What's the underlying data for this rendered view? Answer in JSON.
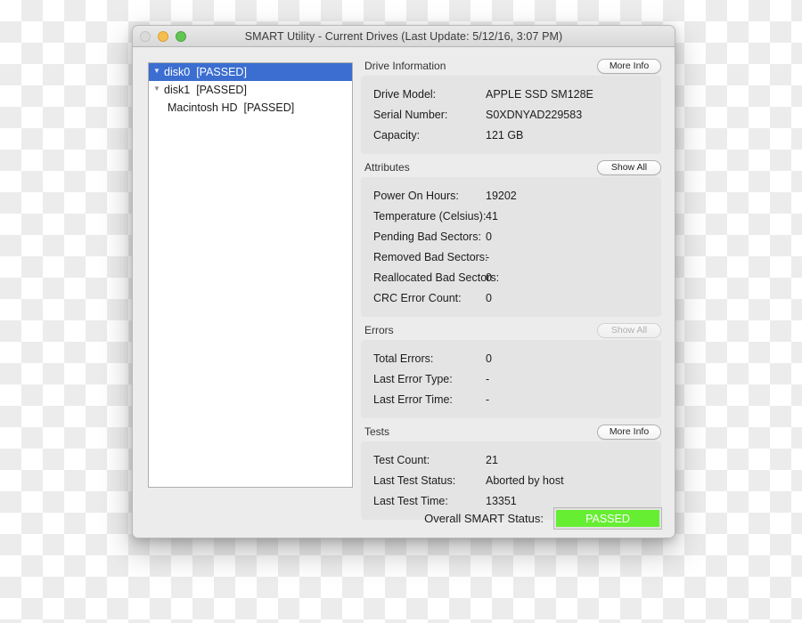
{
  "window": {
    "title": "SMART Utility - Current Drives (Last Update: 5/12/16, 3:07 PM)",
    "traffic_lights": {
      "close": "close-button",
      "minimize": "minimize-button",
      "zoom": "zoom-button"
    }
  },
  "drive_list": [
    {
      "name": "disk0",
      "status": "[PASSED]",
      "expanded": true,
      "indent": false,
      "selected": true
    },
    {
      "name": "disk1",
      "status": "[PASSED]",
      "expanded": true,
      "indent": false,
      "selected": false
    },
    {
      "name": "Macintosh HD",
      "status": "[PASSED]",
      "expanded": false,
      "indent": true,
      "selected": false
    }
  ],
  "sections": [
    {
      "title": "Drive Information",
      "button": {
        "label": "More Info",
        "disabled": false
      },
      "rows": [
        {
          "label": "Drive Model:",
          "value": "APPLE SSD SM128E"
        },
        {
          "label": "Serial Number:",
          "value": "S0XDNYAD229583"
        },
        {
          "label": "Capacity:",
          "value": "121 GB"
        }
      ]
    },
    {
      "title": "Attributes",
      "button": {
        "label": "Show All",
        "disabled": false
      },
      "rows": [
        {
          "label": "Power On Hours:",
          "value": "19202"
        },
        {
          "label": "Temperature (Celsius):",
          "value": "41"
        },
        {
          "label": "Pending Bad Sectors:",
          "value": "0"
        },
        {
          "label": "Removed Bad Sectors:",
          "value": "-"
        },
        {
          "label": "Reallocated Bad Sectors:",
          "value": "0"
        },
        {
          "label": "CRC Error Count:",
          "value": "0"
        }
      ]
    },
    {
      "title": "Errors",
      "button": {
        "label": "Show All",
        "disabled": true
      },
      "rows": [
        {
          "label": "Total Errors:",
          "value": "0"
        },
        {
          "label": "Last Error Type:",
          "value": "-"
        },
        {
          "label": "Last Error Time:",
          "value": "-"
        }
      ]
    },
    {
      "title": "Tests",
      "button": {
        "label": "More Info",
        "disabled": false
      },
      "rows": [
        {
          "label": "Test Count:",
          "value": "21"
        },
        {
          "label": "Last Test Status:",
          "value": "Aborted by host"
        },
        {
          "label": "Last Test Time:",
          "value": "13351"
        }
      ]
    }
  ],
  "footer": {
    "label": "Overall SMART Status:",
    "status": "PASSED",
    "status_color": "#66ee33"
  },
  "icons": {
    "disclosure_expanded": "▼"
  }
}
